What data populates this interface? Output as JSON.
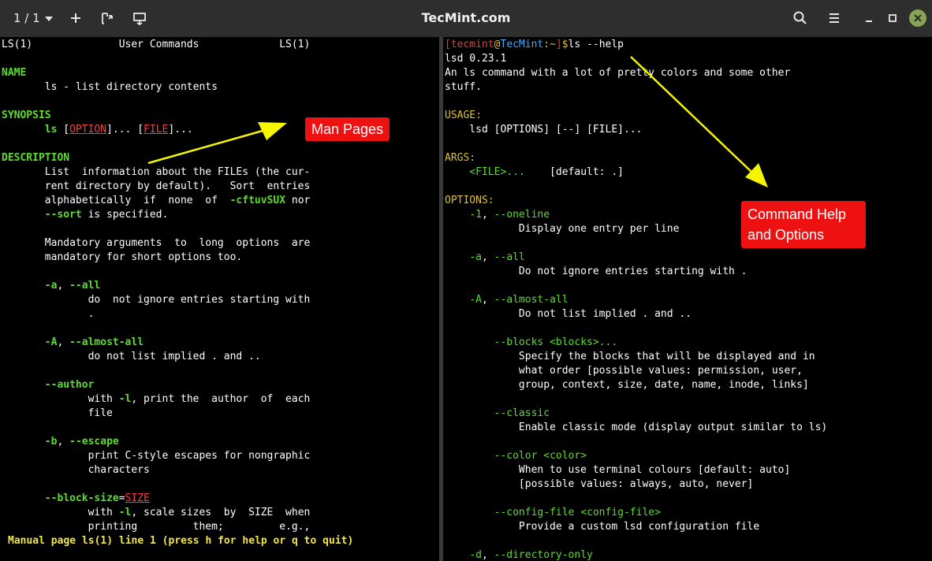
{
  "window": {
    "tab_count": "1 / 1",
    "title": "TecMint.com"
  },
  "icons": {
    "new_tab": "plus-icon",
    "split": "split-icon",
    "hsplit": "hsplit-icon",
    "search": "search-icon",
    "menu": "hamburger-icon",
    "minimize": "minimize-icon",
    "maximize": "maximize-icon",
    "close": "close-icon"
  },
  "colors": {
    "accent_close": "#87a556",
    "callout": "#ee1111",
    "arrow": "#f5f500"
  },
  "left_pane": {
    "lines": [
      [
        {
          "t": "LS(1)              User Commands             LS(1)"
        }
      ],
      [
        {
          "t": ""
        }
      ],
      [
        {
          "t": "NAME",
          "c": "g"
        }
      ],
      [
        {
          "t": "       ls - list directory contents"
        }
      ],
      [
        {
          "t": ""
        }
      ],
      [
        {
          "t": "SYNOPSIS",
          "c": "g"
        }
      ],
      [
        {
          "t": "       "
        },
        {
          "t": "ls",
          "c": "g"
        },
        {
          "t": " ["
        },
        {
          "t": "OPTION",
          "c": "red"
        },
        {
          "t": "]... ["
        },
        {
          "t": "FILE",
          "c": "red"
        },
        {
          "t": "]..."
        }
      ],
      [
        {
          "t": ""
        }
      ],
      [
        {
          "t": "DESCRIPTION",
          "c": "g"
        }
      ],
      [
        {
          "t": "       List  information about the FILEs (the cur‐"
        }
      ],
      [
        {
          "t": "       rent directory by default).   Sort  entries"
        }
      ],
      [
        {
          "t": "       alphabetically  if  none  of  "
        },
        {
          "t": "-cftuvSUX",
          "c": "g"
        },
        {
          "t": " nor"
        }
      ],
      [
        {
          "t": "       "
        },
        {
          "t": "--sort",
          "c": "g"
        },
        {
          "t": " is specified."
        }
      ],
      [
        {
          "t": ""
        }
      ],
      [
        {
          "t": "       Mandatory arguments  to  long  options  are"
        }
      ],
      [
        {
          "t": "       mandatory for short options too."
        }
      ],
      [
        {
          "t": ""
        }
      ],
      [
        {
          "t": "       "
        },
        {
          "t": "-a",
          "c": "g"
        },
        {
          "t": ", "
        },
        {
          "t": "--all",
          "c": "g"
        }
      ],
      [
        {
          "t": "              do  not ignore entries starting with"
        }
      ],
      [
        {
          "t": "              ."
        }
      ],
      [
        {
          "t": ""
        }
      ],
      [
        {
          "t": "       "
        },
        {
          "t": "-A",
          "c": "g"
        },
        {
          "t": ", "
        },
        {
          "t": "--almost-all",
          "c": "g"
        }
      ],
      [
        {
          "t": "              do not list implied . and .."
        }
      ],
      [
        {
          "t": ""
        }
      ],
      [
        {
          "t": "       "
        },
        {
          "t": "--author",
          "c": "g"
        }
      ],
      [
        {
          "t": "              with "
        },
        {
          "t": "-l",
          "c": "g"
        },
        {
          "t": ", print the  author  of  each"
        }
      ],
      [
        {
          "t": "              file"
        }
      ],
      [
        {
          "t": ""
        }
      ],
      [
        {
          "t": "       "
        },
        {
          "t": "-b",
          "c": "g"
        },
        {
          "t": ", "
        },
        {
          "t": "--escape",
          "c": "g"
        }
      ],
      [
        {
          "t": "              print C-style escapes for nongraphic"
        }
      ],
      [
        {
          "t": "              characters"
        }
      ],
      [
        {
          "t": ""
        }
      ],
      [
        {
          "t": "       "
        },
        {
          "t": "--block-size",
          "c": "g"
        },
        {
          "t": "="
        },
        {
          "t": "SIZE",
          "c": "red"
        }
      ],
      [
        {
          "t": "              with "
        },
        {
          "t": "-l",
          "c": "g"
        },
        {
          "t": ", scale sizes  by  SIZE  when"
        }
      ],
      [
        {
          "t": "              printing         them;         e.g.,"
        }
      ]
    ],
    "status": "Manual page ls(1) line 1 (press h for help or q to quit)"
  },
  "right_pane": {
    "lines": [
      [
        {
          "t": "[",
          "c": "pr"
        },
        {
          "t": "tecmint",
          "c": "pr"
        },
        {
          "t": "@",
          "c": "y"
        },
        {
          "t": "TecMint",
          "c": "ht"
        },
        {
          "t": ":~",
          "c": "y"
        },
        {
          "t": "]",
          "c": "pr"
        },
        {
          "t": "$",
          "c": "y"
        },
        {
          "t": "ls --help"
        }
      ],
      [
        {
          "t": "lsd 0.23.1"
        }
      ],
      [
        {
          "t": "An ls command with a lot of pretty colors and some other"
        }
      ],
      [
        {
          "t": "stuff."
        }
      ],
      [
        {
          "t": ""
        }
      ],
      [
        {
          "t": "USAGE:",
          "c": "y"
        }
      ],
      [
        {
          "t": "    lsd [OPTIONS] [--] [FILE]..."
        }
      ],
      [
        {
          "t": ""
        }
      ],
      [
        {
          "t": "ARGS:",
          "c": "y"
        }
      ],
      [
        {
          "t": "    "
        },
        {
          "t": "<FILE>...",
          "c": "gn"
        },
        {
          "t": "    [default: .]"
        }
      ],
      [
        {
          "t": ""
        }
      ],
      [
        {
          "t": "OPTIONS:",
          "c": "y"
        }
      ],
      [
        {
          "t": "    "
        },
        {
          "t": "-1",
          "c": "gn"
        },
        {
          "t": ", "
        },
        {
          "t": "--oneline",
          "c": "gn"
        }
      ],
      [
        {
          "t": "            Display one entry per line"
        }
      ],
      [
        {
          "t": ""
        }
      ],
      [
        {
          "t": "    "
        },
        {
          "t": "-a",
          "c": "gn"
        },
        {
          "t": ", "
        },
        {
          "t": "--all",
          "c": "gn"
        }
      ],
      [
        {
          "t": "            Do not ignore entries starting with ."
        }
      ],
      [
        {
          "t": ""
        }
      ],
      [
        {
          "t": "    "
        },
        {
          "t": "-A",
          "c": "gn"
        },
        {
          "t": ", "
        },
        {
          "t": "--almost-all",
          "c": "gn"
        }
      ],
      [
        {
          "t": "            Do not list implied . and .."
        }
      ],
      [
        {
          "t": ""
        }
      ],
      [
        {
          "t": "        "
        },
        {
          "t": "--blocks <blocks>...",
          "c": "gn"
        }
      ],
      [
        {
          "t": "            Specify the blocks that will be displayed and in"
        }
      ],
      [
        {
          "t": "            what order [possible values: permission, user,"
        }
      ],
      [
        {
          "t": "            group, context, size, date, name, inode, links]"
        }
      ],
      [
        {
          "t": ""
        }
      ],
      [
        {
          "t": "        "
        },
        {
          "t": "--classic",
          "c": "gn"
        }
      ],
      [
        {
          "t": "            Enable classic mode (display output similar to ls)"
        }
      ],
      [
        {
          "t": ""
        }
      ],
      [
        {
          "t": "        "
        },
        {
          "t": "--color <color>",
          "c": "gn"
        }
      ],
      [
        {
          "t": "            When to use terminal colours [default: auto]"
        }
      ],
      [
        {
          "t": "            [possible values: always, auto, never]"
        }
      ],
      [
        {
          "t": ""
        }
      ],
      [
        {
          "t": "        "
        },
        {
          "t": "--config-file <config-file>",
          "c": "gn"
        }
      ],
      [
        {
          "t": "            Provide a custom lsd configuration file"
        }
      ],
      [
        {
          "t": ""
        }
      ],
      [
        {
          "t": "    "
        },
        {
          "t": "-d",
          "c": "gn"
        },
        {
          "t": ", "
        },
        {
          "t": "--directory-only",
          "c": "gn"
        }
      ]
    ]
  },
  "callouts": {
    "man_pages": "Man Pages",
    "help_line1": "Command Help",
    "help_line2": "and Options"
  }
}
